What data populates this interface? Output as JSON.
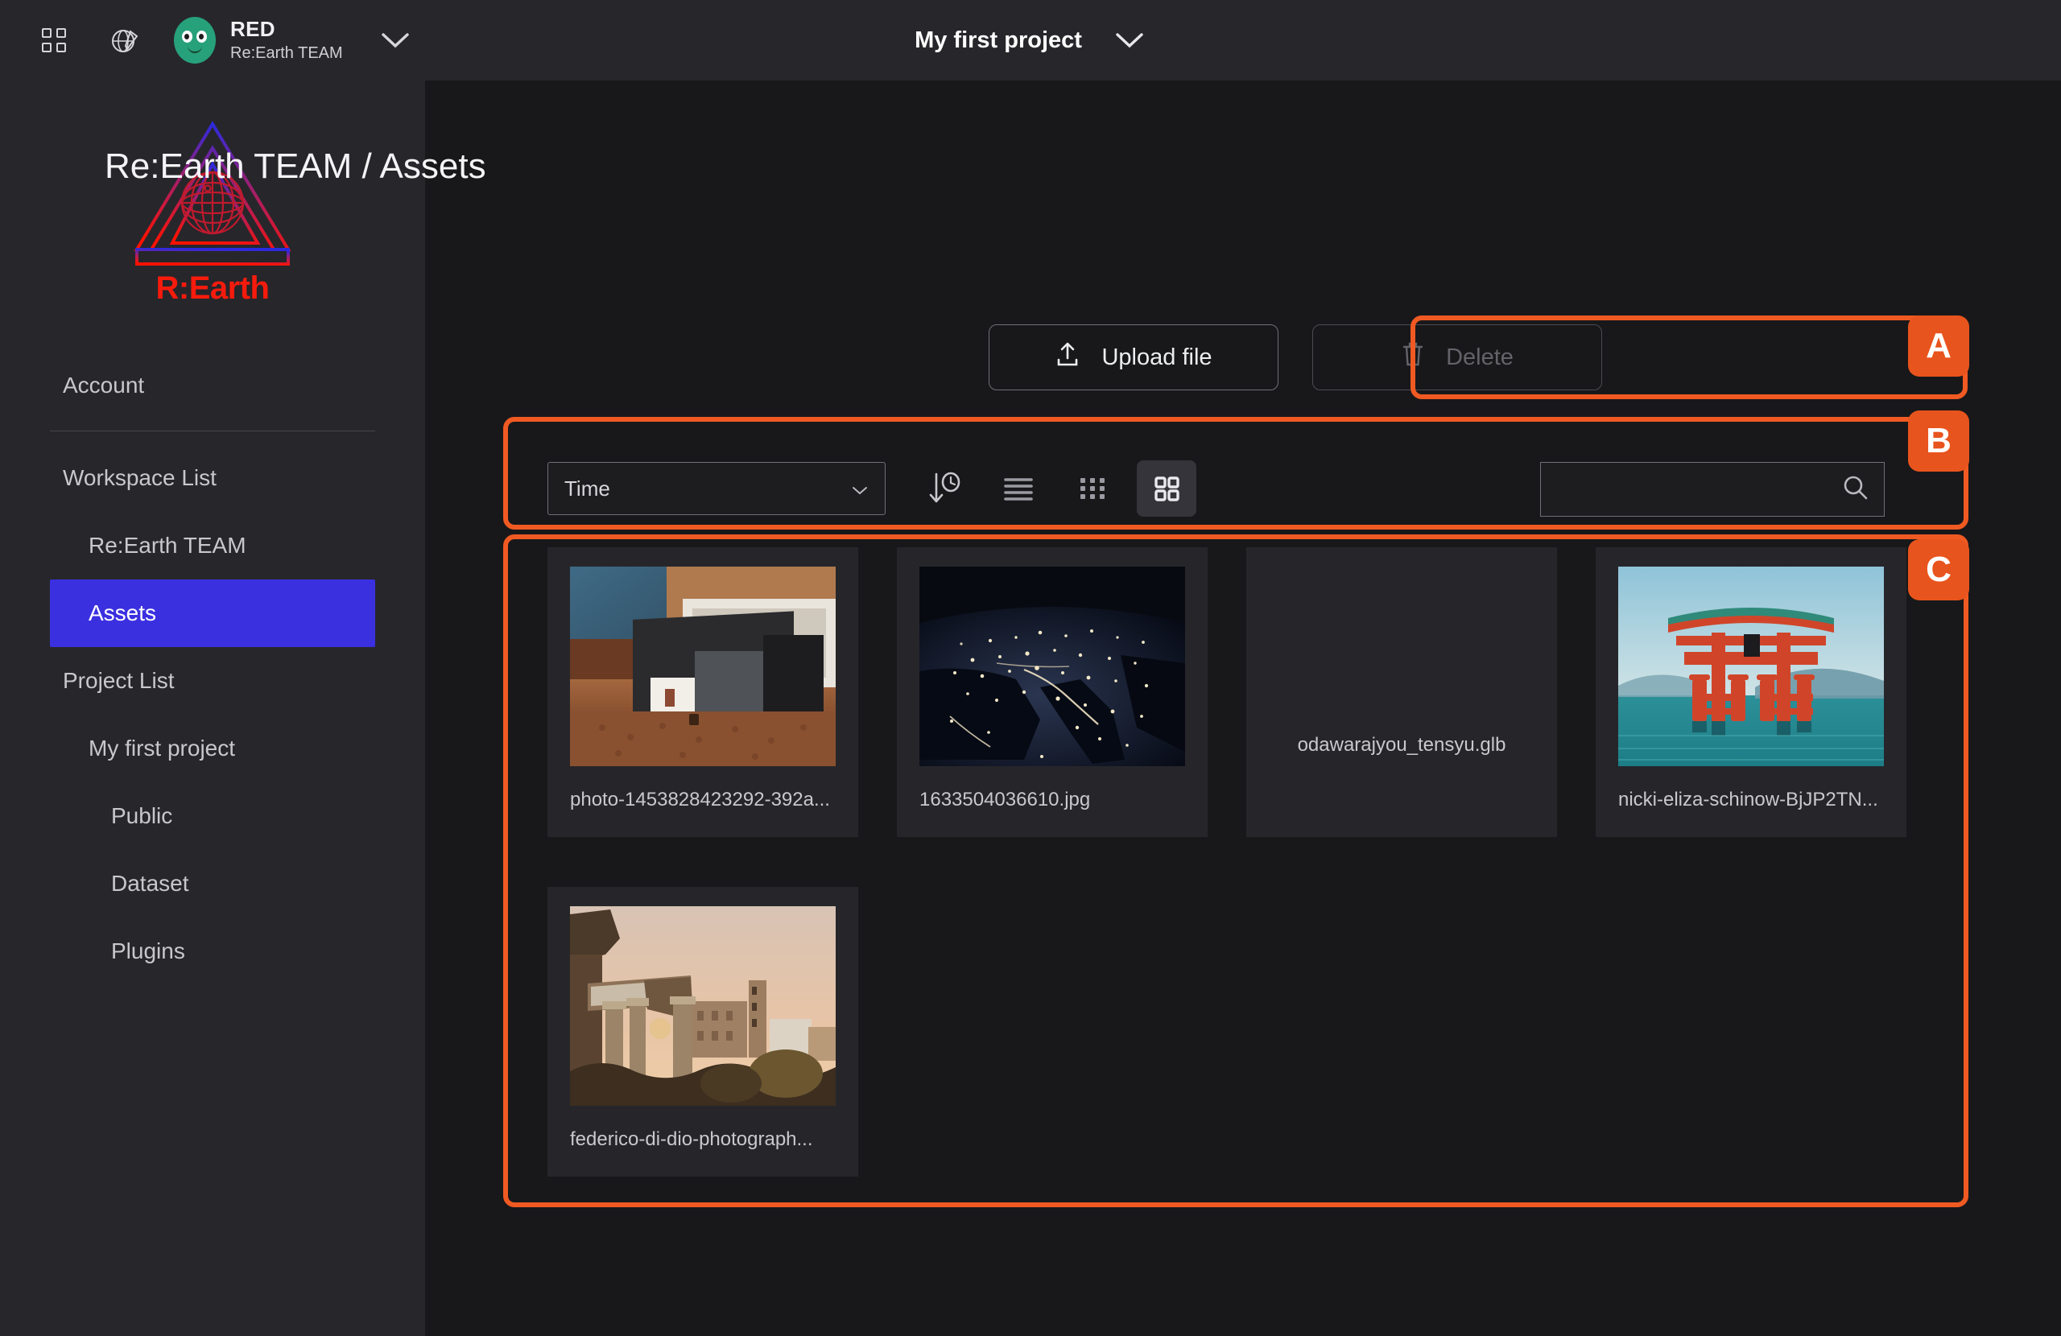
{
  "topbar": {
    "apps_icon": "grid-apps-icon",
    "globe_icon": "globe-pen-icon",
    "avatar_icon": "avatar",
    "user_name": "RED",
    "user_team": "Re:Earth TEAM",
    "user_chevron": "chevron-down-icon",
    "project_name": "My first project",
    "project_chevron": "chevron-down-icon"
  },
  "sidebar": {
    "logo_text": "R:Earth",
    "items": [
      {
        "label": "Account",
        "level": 0,
        "active": false
      },
      {
        "label": "Workspace List",
        "level": 0,
        "active": false
      },
      {
        "label": "Re:Earth TEAM",
        "level": 1,
        "active": false
      },
      {
        "label": "Assets",
        "level": 1,
        "active": true
      },
      {
        "label": "Project List",
        "level": 0,
        "active": false
      },
      {
        "label": "My first project",
        "level": 1,
        "active": false
      },
      {
        "label": "Public",
        "level": 2,
        "active": false
      },
      {
        "label": "Dataset",
        "level": 2,
        "active": false
      },
      {
        "label": "Plugins",
        "level": 2,
        "active": false
      }
    ]
  },
  "main": {
    "page_title": "Re:Earth TEAM / Assets",
    "upload_button": "Upload file",
    "upload_icon": "upload-icon",
    "delete_button": "Delete",
    "delete_icon": "trash-icon",
    "delete_disabled": true
  },
  "toolbar": {
    "sort_select_value": "Time",
    "sort_select_chevron": "chevron-down-icon",
    "sort_direction_icon": "sort-by-time-icon",
    "view_list_icon": "list-view-icon",
    "view_small_grid_icon": "small-grid-view-icon",
    "view_large_grid_icon": "large-grid-view-icon",
    "active_view": "large-grid",
    "search_value": "",
    "search_placeholder": "",
    "search_icon": "search-icon"
  },
  "assets": [
    {
      "name": "photo-1453828423292-392a...",
      "thumb": "vintage-photo-box",
      "has_thumb": true
    },
    {
      "name": "1633504036610.jpg",
      "thumb": "earth-at-night-europe",
      "has_thumb": true
    },
    {
      "name": "odawarajyou_tensyu.glb",
      "thumb": "none",
      "has_thumb": false
    },
    {
      "name": "nicki-eliza-schinow-BjJP2TN...",
      "thumb": "itsukushima-torii-gate",
      "has_thumb": true
    },
    {
      "name": "federico-di-dio-photograph...",
      "thumb": "roman-forum-sunset",
      "has_thumb": true
    }
  ],
  "callouts": [
    {
      "letter": "A"
    },
    {
      "letter": "B"
    },
    {
      "letter": "C"
    }
  ],
  "colors": {
    "accent_orange": "#e8541d",
    "sidebar_active": "#3b30e0",
    "sidebar_bg": "#27262b",
    "main_bg": "#18181a",
    "card_bg": "#26262a",
    "logo_red": "#f61b0c"
  }
}
